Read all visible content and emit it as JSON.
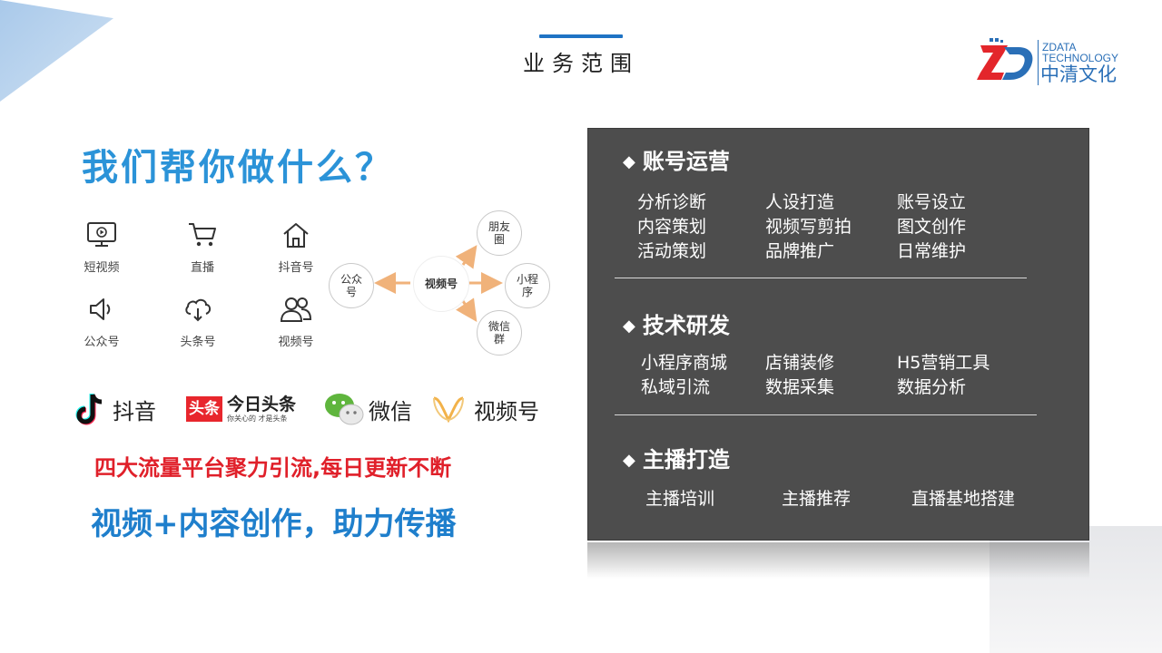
{
  "header": {
    "title": "业务范围"
  },
  "logo": {
    "en_line1": "ZDATA",
    "en_line2": "TECHNOLOGY",
    "cn": "中清文化"
  },
  "main_title": "我们帮你做什么？",
  "icons": [
    {
      "icon": "monitor-play-icon",
      "label": "短视频"
    },
    {
      "icon": "cart-icon",
      "label": "直播"
    },
    {
      "icon": "home-icon",
      "label": "抖音号"
    },
    {
      "icon": "speaker-icon",
      "label": "公众号"
    },
    {
      "icon": "cloud-download-icon",
      "label": "头条号"
    },
    {
      "icon": "users-icon",
      "label": "视频号"
    }
  ],
  "network": {
    "center": "视频号",
    "left": "公众号",
    "top": "朋友圈",
    "right": "小程序",
    "bottom": "微信群"
  },
  "brands": {
    "douyin": "抖音",
    "toutiao_badge": "头条",
    "toutiao_name": "今日头条",
    "toutiao_slogan": "你关心的 才是头条",
    "weixin": "微信",
    "shipinhao": "视频号"
  },
  "tagline_red": "四大流量平台聚力引流,每日更新不断",
  "tagline_blue": "视频+内容创作，助力传播",
  "colors": {
    "title_blue": "#2b93d8",
    "tagline_red": "#e0202a",
    "tagline_blue": "#1f7fcc",
    "panel_bg": "#4d4d4d",
    "arrow_orange": "#f0b27a"
  },
  "panel": {
    "sections": [
      {
        "heading": "账号运营",
        "items": [
          [
            "分析诊断",
            "内容策划",
            "活动策划"
          ],
          [
            "人设打造",
            "视频写剪拍",
            "品牌推广"
          ],
          [
            "账号设立",
            "图文创作",
            "日常维护"
          ]
        ]
      },
      {
        "heading": "技术研发",
        "items": [
          [
            "小程序商城",
            "私域引流"
          ],
          [
            "店铺装修",
            "数据采集"
          ],
          [
            "H5营销工具",
            "数据分析"
          ]
        ]
      },
      {
        "heading": "主播打造",
        "items": [
          [
            "主播培训"
          ],
          [
            "主播推荐"
          ],
          [
            "直播基地搭建"
          ]
        ]
      }
    ]
  }
}
